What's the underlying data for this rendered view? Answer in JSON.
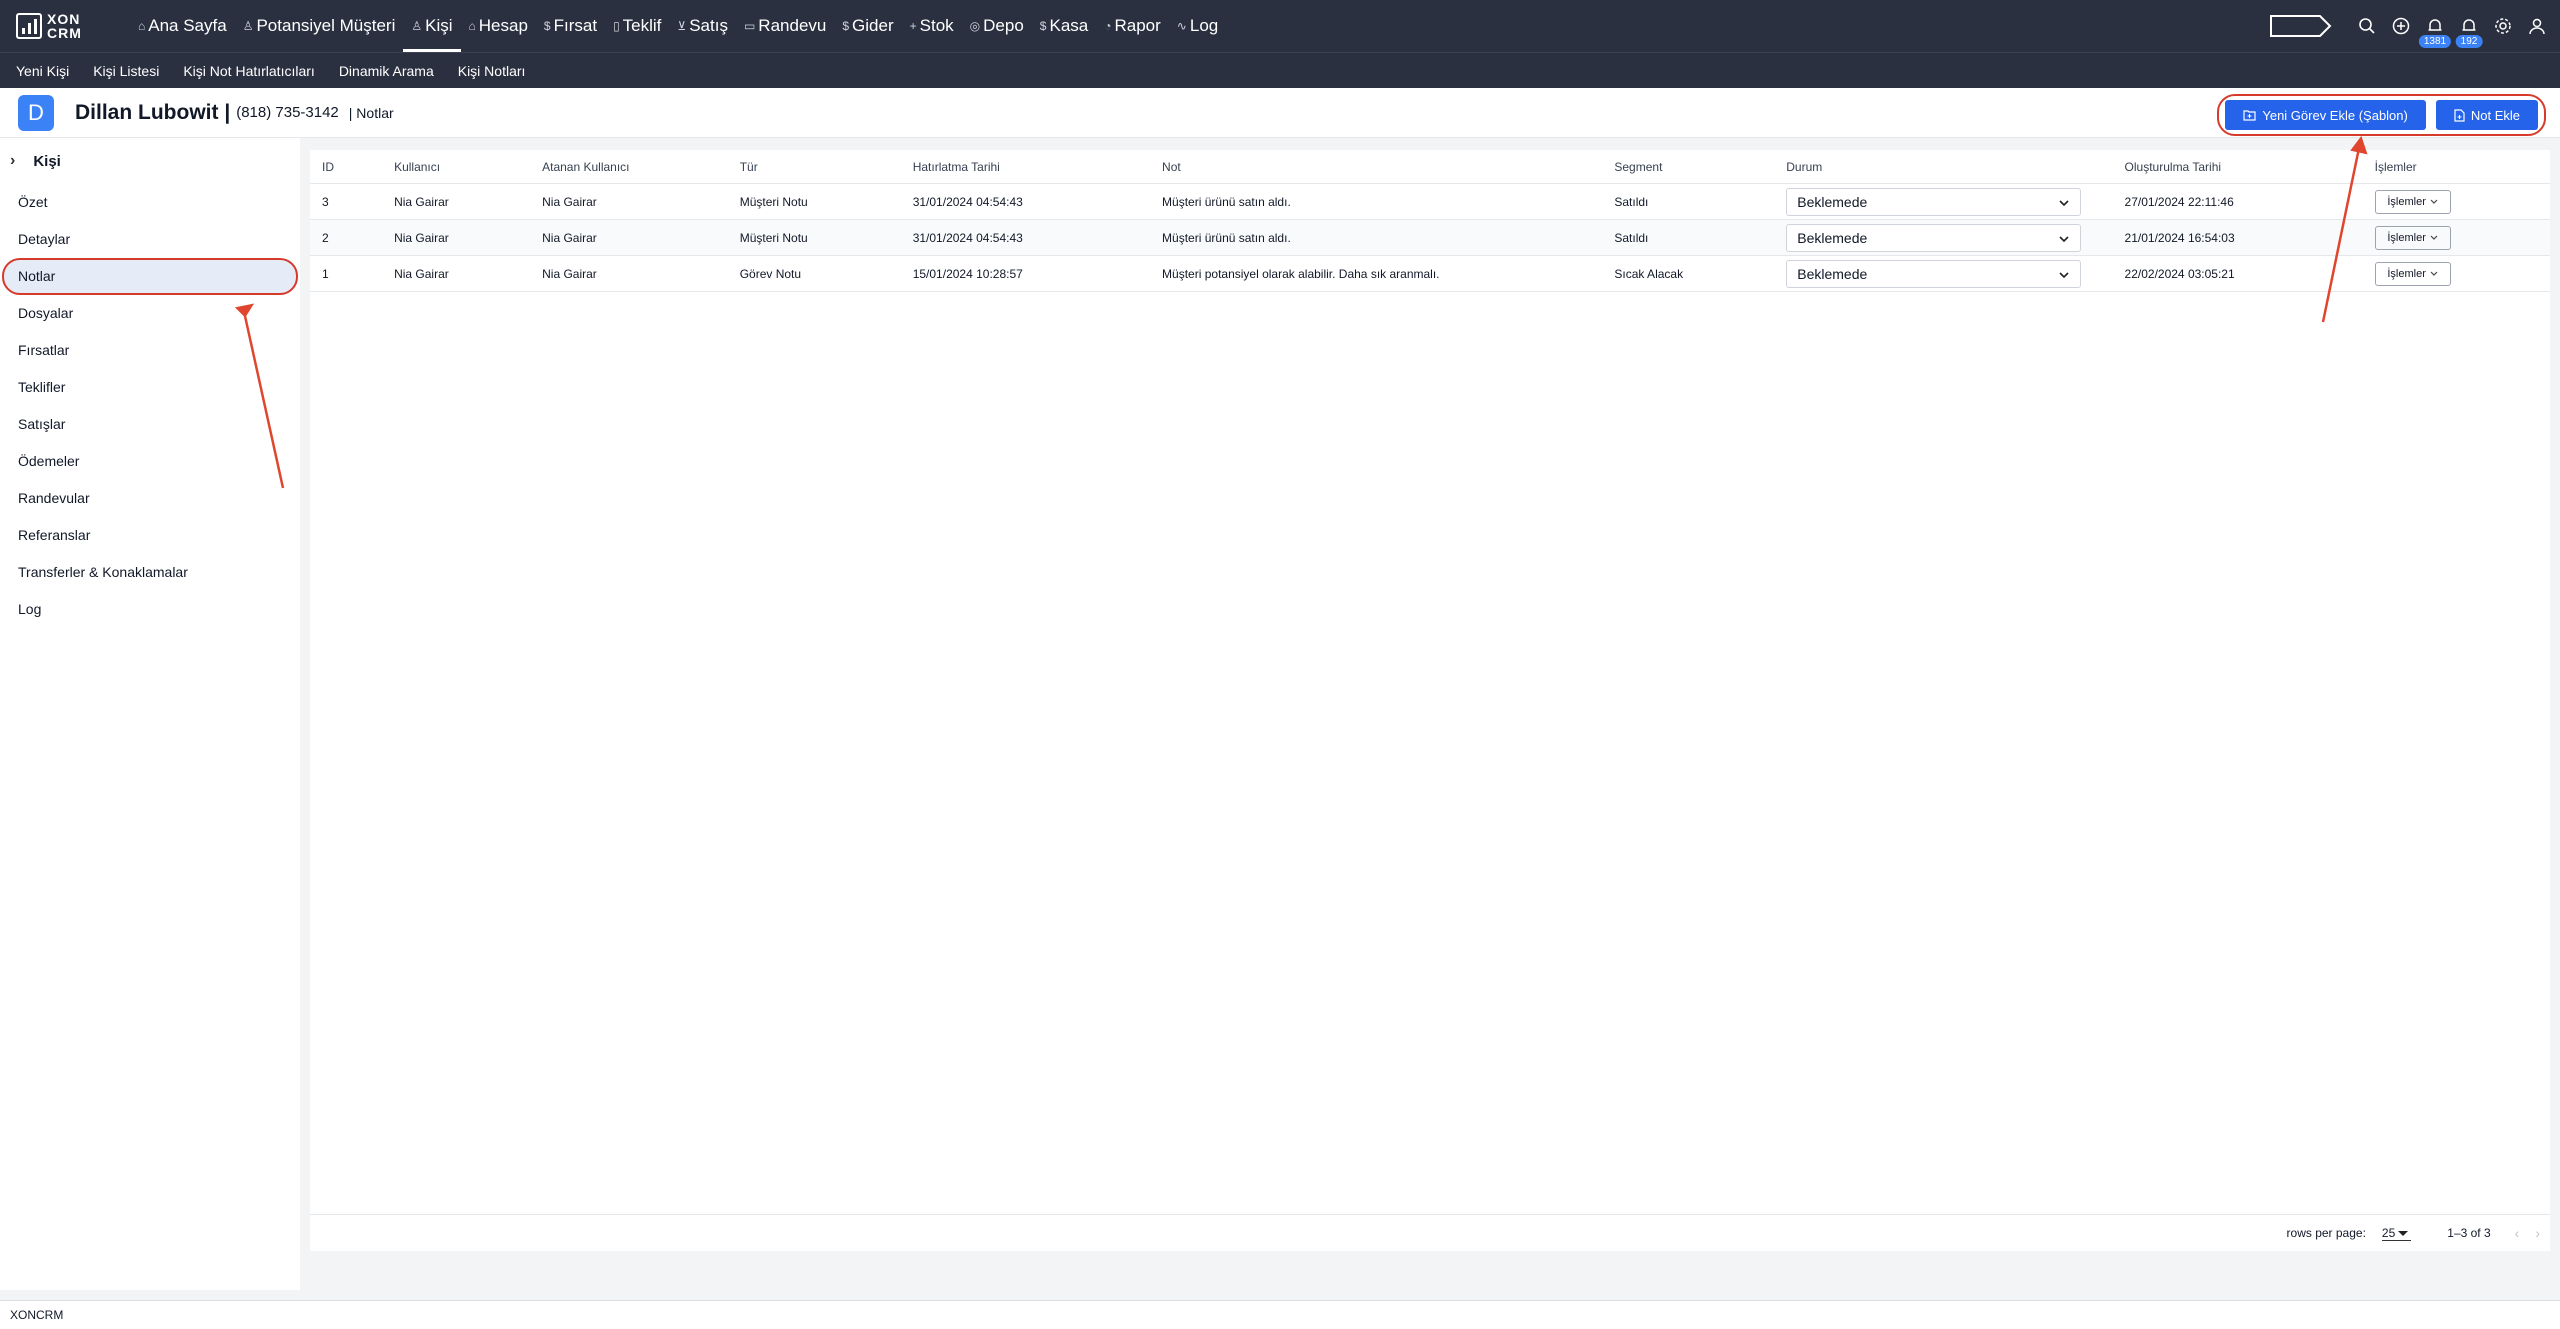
{
  "app": {
    "logo_text_1": "XON",
    "logo_text_2": "CRM"
  },
  "topnav": [
    {
      "label": "Ana Sayfa",
      "icon": "home-icon",
      "glyph": "⌂"
    },
    {
      "label": "Potansiyel Müşteri",
      "icon": "user-icon",
      "glyph": "♙"
    },
    {
      "label": "Kişi",
      "icon": "users-icon",
      "glyph": "♙",
      "active": true
    },
    {
      "label": "Hesap",
      "icon": "building-icon",
      "glyph": "⌂"
    },
    {
      "label": "Fırsat",
      "icon": "dollar-icon",
      "glyph": "$"
    },
    {
      "label": "Teklif",
      "icon": "document-icon",
      "glyph": "▯"
    },
    {
      "label": "Satış",
      "icon": "cart-icon",
      "glyph": "⊻"
    },
    {
      "label": "Randevu",
      "icon": "calendar-icon",
      "glyph": "▭"
    },
    {
      "label": "Gider",
      "icon": "dollar-icon",
      "glyph": "$"
    },
    {
      "label": "Stok",
      "icon": "plus-icon",
      "glyph": "+"
    },
    {
      "label": "Depo",
      "icon": "box-icon",
      "glyph": "◎"
    },
    {
      "label": "Kasa",
      "icon": "dollar-icon",
      "glyph": "$"
    },
    {
      "label": "Rapor",
      "icon": "clock-icon",
      "glyph": "◔"
    },
    {
      "label": "Log",
      "icon": "activity-icon",
      "glyph": "∿"
    }
  ],
  "badges": {
    "notifications_1": "1381",
    "notifications_2": "192"
  },
  "subnav": [
    "Yeni Kişi",
    "Kişi Listesi",
    "Kişi Not Hatırlatıcıları",
    "Dinamik Arama",
    "Kişi Notları"
  ],
  "contact": {
    "initial": "D",
    "name": "Dillan Lubowit |",
    "phone": "(818) 735-3142",
    "section": "| Notlar"
  },
  "buttons": {
    "add_task": "Yeni Görev Ekle (Şablon)",
    "add_note": "Not Ekle"
  },
  "sidebar": {
    "title": "Kişi",
    "items": [
      "Özet",
      "Detaylar",
      "Notlar",
      "Dosyalar",
      "Fırsatlar",
      "Teklifler",
      "Satışlar",
      "Ödemeler",
      "Randevular",
      "Referanslar",
      "Transferler & Konaklamalar",
      "Log"
    ],
    "active_index": 2
  },
  "table": {
    "headers": [
      "ID",
      "Kullanıcı",
      "Atanan Kullanıcı",
      "Tür",
      "Hatırlatma Tarihi",
      "Not",
      "Segment",
      "Durum",
      "Oluşturulma Tarihi",
      "İşlemler"
    ],
    "rows": [
      {
        "id": "3",
        "user": "Nia Gairar",
        "assigned": "Nia Gairar",
        "type": "Müşteri Notu",
        "reminder": "31/01/2024 04:54:43",
        "note": "Müşteri ürünü satın aldı.",
        "segment": "Satıldı",
        "status": "Beklemede",
        "created": "27/01/2024 22:11:46",
        "action": "İşlemler"
      },
      {
        "id": "2",
        "user": "Nia Gairar",
        "assigned": "Nia Gairar",
        "type": "Müşteri Notu",
        "reminder": "31/01/2024 04:54:43",
        "note": "Müşteri ürünü satın aldı.",
        "segment": "Satıldı",
        "status": "Beklemede",
        "created": "21/01/2024 16:54:03",
        "action": "İşlemler"
      },
      {
        "id": "1",
        "user": "Nia Gairar",
        "assigned": "Nia Gairar",
        "type": "Görev Notu",
        "reminder": "15/01/2024 10:28:57",
        "note": "Müşteri potansiyel olarak alabilir. Daha sık aranmalı.",
        "segment": "Sıcak Alacak",
        "status": "Beklemede",
        "created": "22/02/2024 03:05:21",
        "action": "İşlemler"
      }
    ]
  },
  "pagination": {
    "rows_per_page_label": "rows per page:",
    "rows_per_page": "25",
    "range": "1–3 of 3"
  },
  "statusbar": "XONCRM",
  "colors": {
    "nav_bg": "#2b3040",
    "accent": "#2563eb",
    "annotation": "#d63a2b"
  }
}
